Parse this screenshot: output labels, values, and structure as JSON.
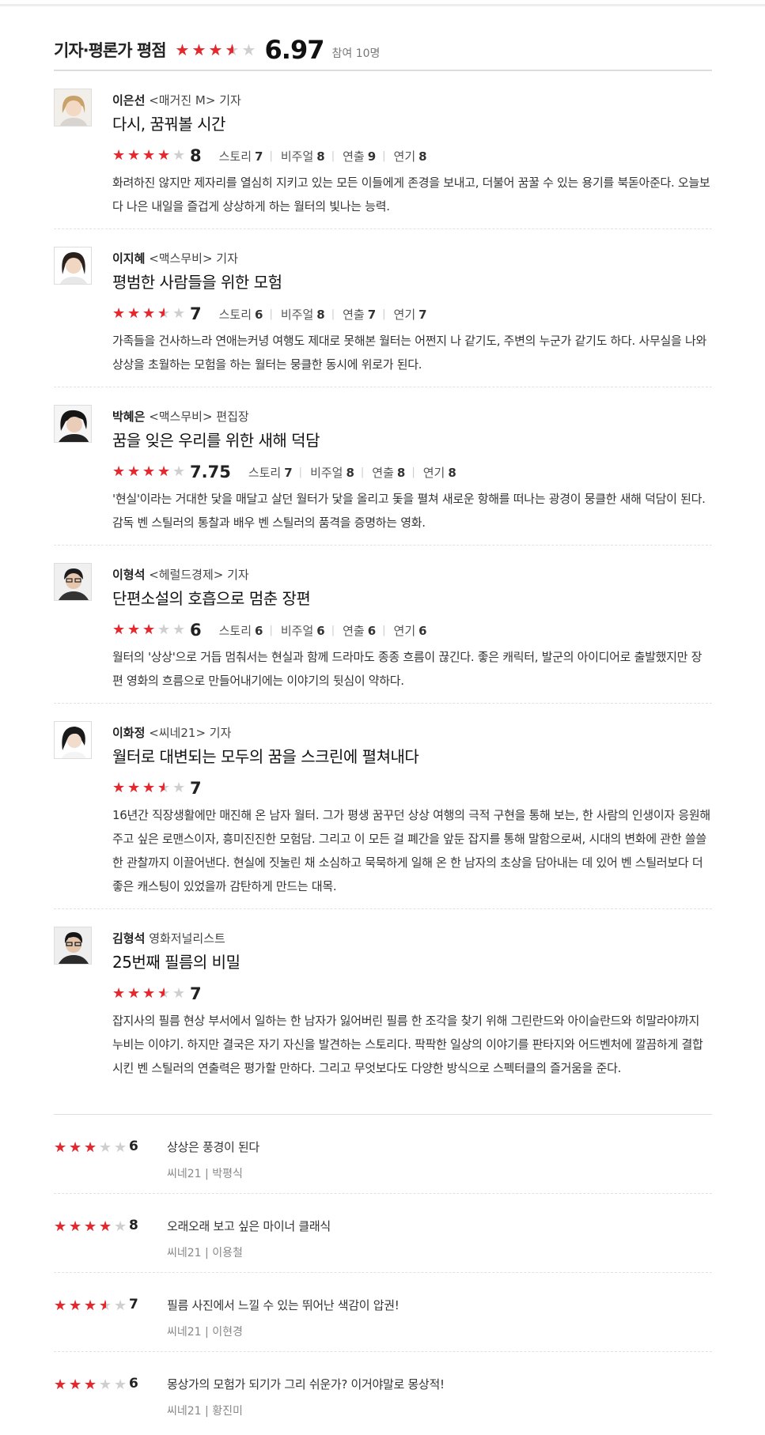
{
  "section": {
    "title": "기자·평론가 평점",
    "score": "6.97",
    "score_value": 6.97,
    "participants": "참여 10명"
  },
  "reviews": [
    {
      "name": "이은선",
      "affiliation": "<매거진 M> 기자",
      "title": "다시, 꿈꿔볼 시간",
      "score": "8",
      "score_value": 8,
      "subscores": [
        {
          "label": "스토리",
          "value": "7"
        },
        {
          "label": "비주얼",
          "value": "8"
        },
        {
          "label": "연출",
          "value": "9"
        },
        {
          "label": "연기",
          "value": "8"
        }
      ],
      "text": "화려하진 않지만 제자리를 열심히 지키고 있는 모든 이들에게 존경을 보내고, 더불어 꿈꿀 수 있는 용기를 북돋아준다. 오늘보다 나은 내일을 즐겁게 상상하게 하는 월터의 빛나는 능력."
    },
    {
      "name": "이지혜",
      "affiliation": "<맥스무비> 기자",
      "title": "평범한 사람들을 위한 모험",
      "score": "7",
      "score_value": 7,
      "subscores": [
        {
          "label": "스토리",
          "value": "6"
        },
        {
          "label": "비주얼",
          "value": "8"
        },
        {
          "label": "연출",
          "value": "7"
        },
        {
          "label": "연기",
          "value": "7"
        }
      ],
      "text": "가족들을 건사하느라 연애는커녕 여행도 제대로 못해본 월터는 어쩐지 나 같기도, 주변의 누군가 같기도 하다. 사무실을 나와 상상을 초월하는 모험을 하는 월터는 뭉클한 동시에 위로가 된다."
    },
    {
      "name": "박혜은",
      "affiliation": "<맥스무비> 편집장",
      "title": "꿈을 잊은 우리를 위한 새해 덕담",
      "score": "7.75",
      "score_value": 7.75,
      "subscores": [
        {
          "label": "스토리",
          "value": "7"
        },
        {
          "label": "비주얼",
          "value": "8"
        },
        {
          "label": "연출",
          "value": "8"
        },
        {
          "label": "연기",
          "value": "8"
        }
      ],
      "text": "'현실'이라는 거대한 닻을 매달고 살던 월터가 닻을 올리고 돛을 펼쳐 새로운 항해를 떠나는 광경이 뭉클한 새해 덕담이 된다. 감독 벤 스틸러의 통찰과 배우 벤 스틸러의 품격을 증명하는 영화."
    },
    {
      "name": "이형석",
      "affiliation": "<헤럴드경제> 기자",
      "title": "단편소설의 호흡으로 멈춘 장편",
      "score": "6",
      "score_value": 6,
      "subscores": [
        {
          "label": "스토리",
          "value": "6"
        },
        {
          "label": "비주얼",
          "value": "6"
        },
        {
          "label": "연출",
          "value": "6"
        },
        {
          "label": "연기",
          "value": "6"
        }
      ],
      "text": "월터의 '상상'으로 거듭 멈춰서는 현실과 함께 드라마도 종종 흐름이 끊긴다. 좋은 캐릭터, 발군의 아이디어로 출발했지만 장편 영화의 흐름으로 만들어내기에는 이야기의 뒷심이 약하다."
    },
    {
      "name": "이화정",
      "affiliation": "<씨네21> 기자",
      "title": "월터로 대변되는 모두의 꿈을 스크린에 펼쳐내다",
      "score": "7",
      "score_value": 7,
      "subscores": [],
      "text": "16년간 직장생활에만 매진해 온 남자 월터. 그가 평생 꿈꾸던 상상 여행의 극적 구현을 통해 보는, 한 사람의 인생이자 응원해주고 싶은 로맨스이자, 흥미진진한 모험담. 그리고 이 모든 걸 폐간을 앞둔 잡지를 통해 말함으로써, 시대의 변화에 관한 쓸쓸한 관찰까지 이끌어낸다. 현실에 짓눌린 채 소심하고 묵묵하게 일해 온 한 남자의 초상을 담아내는 데 있어 벤 스틸러보다 더 좋은 캐스팅이 있었을까 감탄하게 만드는 대목."
    },
    {
      "name": "김형석",
      "affiliation": "영화저널리스트",
      "title": "25번째 필름의 비밀",
      "score": "7",
      "score_value": 7,
      "subscores": [],
      "text": "잡지사의 필름 현상 부서에서 일하는 한 남자가 잃어버린 필름 한 조각을 찾기 위해 그린란드와 아이슬란드와 히말라야까지 누비는 이야기. 하지만 결국은 자기 자신을 발견하는 스토리다. 팍팍한 일상의 이야기를 판타지와 어드벤처에 깔끔하게 결합시킨 벤 스틸러의 연출력은 평가할 만하다. 그리고 무엇보다도 다양한 방식으로 스펙터클의 즐거움을 준다."
    }
  ],
  "short_reviews": [
    {
      "score": "6",
      "score_value": 6,
      "text": "상상은 풍경이 된다",
      "source": "씨네21 |",
      "author": "박평식"
    },
    {
      "score": "8",
      "score_value": 8,
      "text": "오래오래 보고 싶은 마이너 클래식",
      "source": "씨네21 |",
      "author": "이용철"
    },
    {
      "score": "7",
      "score_value": 7,
      "text": "필름 사진에서 느낄 수 있는 뛰어난 색감이 압권!",
      "source": "씨네21 |",
      "author": "이현경"
    },
    {
      "score": "6",
      "score_value": 6,
      "text": "몽상가의 모험가 되기가 그리 쉬운가? 이거야말로 몽상적!",
      "source": "씨네21 |",
      "author": "황진미"
    }
  ],
  "colors": {
    "star_on": "#e6272d",
    "star_off": "#cfcfcf"
  },
  "icons": {
    "star": "star-icon",
    "photo": "reviewer-photo"
  }
}
